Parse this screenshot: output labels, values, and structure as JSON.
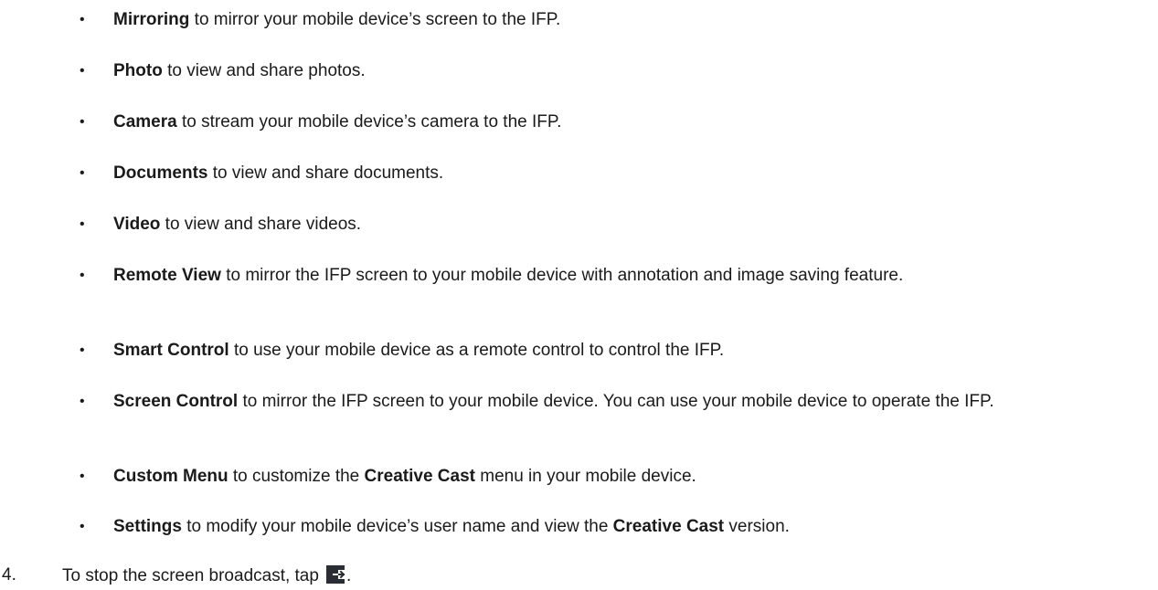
{
  "bullets": [
    {
      "bold": "Mirroring",
      "text": " to mirror your mobile device’s screen to the IFP."
    },
    {
      "bold": "Photo",
      "text": " to view and share photos."
    },
    {
      "bold": "Camera",
      "text": " to stream your mobile device’s camera to the IFP."
    },
    {
      "bold": "Documents",
      "text": " to view and share documents."
    },
    {
      "bold": "Video",
      "text": " to view and share videos."
    },
    {
      "bold": "Remote View",
      "text": " to mirror the IFP screen to your mobile device with annotation and image saving feature."
    },
    {
      "bold": "Smart Control",
      "text": " to use your mobile device as a remote control to control the IFP."
    },
    {
      "bold": "Screen Control",
      "text": " to mirror the IFP screen to your mobile device. You can use your mobile device to operate the IFP."
    },
    {
      "bold": "Custom Menu",
      "text": " to customize the ",
      "bold2": "Creative Cast",
      "text2": " menu in your mobile device."
    },
    {
      "bold": "Settings",
      "text": " to modify your mobile device’s user name and view the ",
      "bold2": "Creative Cast",
      "text2": " version."
    }
  ],
  "bullet_char": "•",
  "step": {
    "number": "4.",
    "text": "To stop the screen broadcast, tap",
    "after_icon": ".",
    "icon": "exit-broadcast-icon"
  }
}
